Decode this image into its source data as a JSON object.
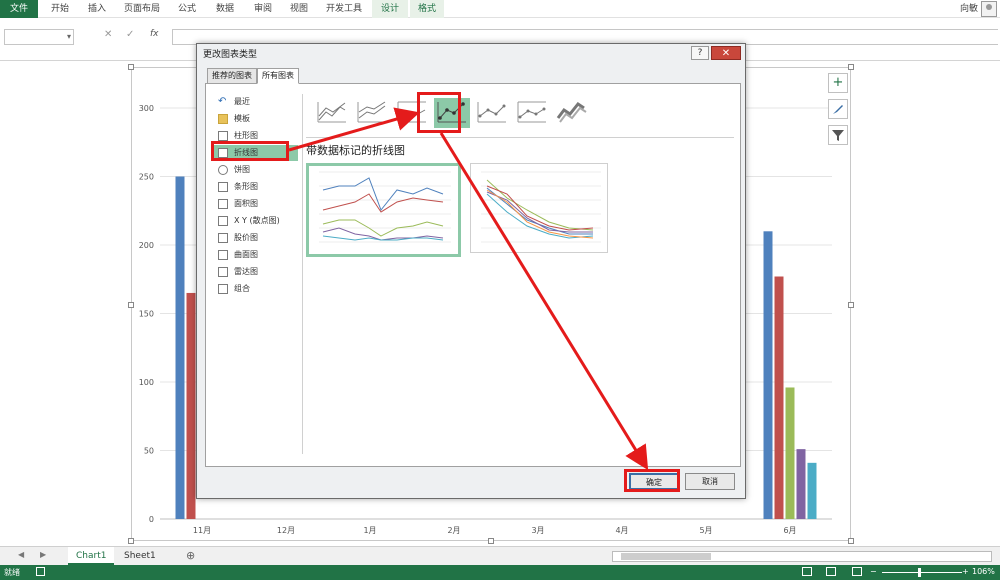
{
  "ribbon": {
    "tabs": [
      "文件",
      "开始",
      "插入",
      "页面布局",
      "公式",
      "数据",
      "审阅",
      "视图",
      "开发工具",
      "设计",
      "格式"
    ],
    "user_name": "向敏"
  },
  "formula_bar": {
    "name_value": "",
    "cancel_glyph": "✕",
    "enter_glyph": "✓",
    "fx_label": "fx",
    "formula_value": ""
  },
  "chart_data": {
    "type": "bar",
    "categories": [
      "11月",
      "12月",
      "1月",
      "2月",
      "3月",
      "4月",
      "5月",
      "6月"
    ],
    "y_ticks": [
      "0",
      "50",
      "100",
      "150",
      "200",
      "250",
      "300"
    ],
    "ylim": [
      0,
      300
    ],
    "series": [
      {
        "color": "#4f81bd",
        "values": [
          250,
          0,
          0,
          0,
          0,
          0,
          0,
          210
        ]
      },
      {
        "color": "#c0504d",
        "values": [
          165,
          0,
          0,
          0,
          0,
          0,
          0,
          177
        ]
      },
      {
        "color": "#9bbb59",
        "values": [
          0,
          0,
          0,
          0,
          0,
          0,
          0,
          96
        ]
      },
      {
        "color": "#8064a2",
        "values": [
          0,
          0,
          0,
          0,
          0,
          0,
          0,
          51
        ]
      },
      {
        "color": "#4bacc6",
        "values": [
          0,
          0,
          0,
          0,
          0,
          0,
          0,
          41
        ]
      }
    ]
  },
  "chart_tools": {
    "add_glyph": "+"
  },
  "dialog": {
    "title": "更改图表类型",
    "help": "?",
    "close": "✕",
    "tabs": [
      "推荐的图表",
      "所有图表"
    ],
    "chart_types": [
      "最近",
      "模板",
      "柱形图",
      "折线图",
      "饼图",
      "条形图",
      "面积图",
      "X Y (散点图)",
      "股价图",
      "曲面图",
      "雷达图",
      "组合"
    ],
    "selected_type": "折线图",
    "subtype_title": "带数据标记的折线图",
    "ok_label": "确定",
    "cancel_label": "取消"
  },
  "sheet_tabs": {
    "tabs": [
      "Chart1",
      "Sheet1"
    ],
    "active": "Chart1",
    "add": "⊕"
  },
  "status": {
    "ready": "就绪",
    "zoom": "106%"
  }
}
